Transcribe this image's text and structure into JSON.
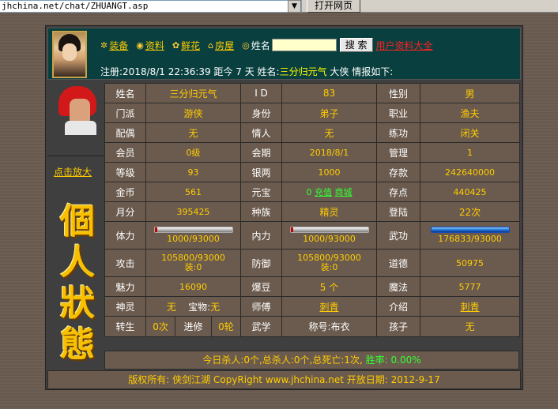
{
  "browser": {
    "address": "jhchina.net/chat/ZHUANGT.asp",
    "go_label": "打开网页"
  },
  "header": {
    "nav": [
      {
        "icon": "gear-icon",
        "label": "装备"
      },
      {
        "icon": "coins-icon",
        "label": "资料"
      },
      {
        "icon": "flower-icon",
        "label": "鲜花"
      },
      {
        "icon": "house-icon",
        "label": "房屋"
      }
    ],
    "name_label": "姓名",
    "search_value": "",
    "search_label": "搜 索",
    "all_users_label": "用户资料大全",
    "reg_prefix": "注册:2018/8/1 22:36:39 距今 7 天 姓名:",
    "reg_name": "三分归元气",
    "reg_suffix": " 大侠 情报如下:"
  },
  "left": {
    "zoom_label": "点击放大",
    "title_chars": [
      "個",
      "人",
      "狀",
      "態"
    ]
  },
  "stats": {
    "r1": {
      "k1": "姓名",
      "v1": "三分归元气",
      "k2": "I D",
      "v2": "83",
      "k3": "性别",
      "v3": "男"
    },
    "r2": {
      "k1": "门派",
      "v1": "游侠",
      "k2": "身份",
      "v2": "弟子",
      "k3": "职业",
      "v3": "渔夫"
    },
    "r3": {
      "k1": "配偶",
      "v1": "无",
      "k2": "情人",
      "v2": "无",
      "k3": "练功",
      "v3": "闭关"
    },
    "r4": {
      "k1": "会员",
      "v1": "0级",
      "k2": "会期",
      "v2": "2018/8/1",
      "k3": "管理",
      "v3": "1"
    },
    "r5": {
      "k1": "等级",
      "v1": "93",
      "k2": "银两",
      "v2": "1000",
      "k3": "存款",
      "v3": "242640000"
    },
    "r6": {
      "k1": "金币",
      "v1": "561",
      "k2": "元宝",
      "v2_num": "0",
      "v2_link1": "充值",
      "v2_link2": "商城",
      "k3": "存点",
      "v3": "440425"
    },
    "r7": {
      "k1": "月分",
      "v1": "395425",
      "k2": "种族",
      "v2": "精灵",
      "k3": "登陆",
      "v3": "22次"
    },
    "r8": {
      "k1": "体力",
      "v1": "1000/93000",
      "v1_fill": 0.011,
      "k2": "内力",
      "v2": "1000/93000",
      "v2_fill": 0.011,
      "k3": "武功",
      "v3": "176833/93000",
      "v3_fill": 1.0
    },
    "r9": {
      "k1": "攻击",
      "v1a": "105800/93000",
      "v1b": "装:0",
      "k2": "防御",
      "v2a": "105800/93000",
      "v2b": "装:0",
      "k3": "道德",
      "v3": "50975"
    },
    "r10": {
      "k1": "魅力",
      "v1": "16090",
      "k2": "爆豆",
      "v2": "5 个",
      "k3": "魔法",
      "v3": "5777"
    },
    "r11": {
      "k1": "神灵",
      "v1a": "无",
      "v1b_label": "宝物:",
      "v1b": "无",
      "k2": "师傅",
      "v2": "刺青",
      "k3": "介绍",
      "v3": "刺青"
    },
    "r12": {
      "k1": "转生",
      "v1a": "0次",
      "v1b": "进修",
      "v1c": "0轮",
      "k2": "武学",
      "v2": "称号:布衣",
      "k3": "孩子",
      "v3": "无"
    }
  },
  "footer": {
    "kills_text": "今日杀人:0个,总杀人:0个,总死亡:1次,",
    "win_text": " 胜率: 0.00%",
    "copyright": "版权所有: 侠剑江湖 CopyRight www.jhchina.net  开放日期: 2012-9-17"
  }
}
